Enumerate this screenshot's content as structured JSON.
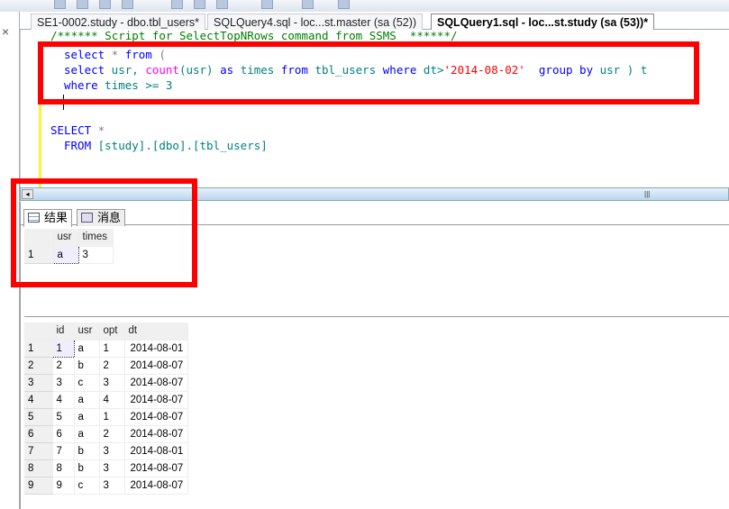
{
  "editor_tabs": [
    {
      "label": "SE1-0002.study - dbo.tbl_users*",
      "active": false
    },
    {
      "label": "SQLQuery4.sql - loc...st.master (sa (52))",
      "active": false
    },
    {
      "label": "SQLQuery1.sql - loc...st.study (sa (53))*",
      "active": true
    }
  ],
  "close_label": "×",
  "code": {
    "comment": "/****** Script for SelectTopNRows command from SSMS  ******/",
    "line1": {
      "a": "select",
      "b": " * ",
      "c": "from",
      "d": " ("
    },
    "line2": {
      "a": "select",
      "b": " usr, ",
      "c": "count",
      "d": "(usr) ",
      "e": "as",
      "f": " times ",
      "g": "from",
      "h": " tbl_users ",
      "i": "where",
      "j": " dt>",
      "k": "'2014-08-02'",
      "l": "  ",
      "m": "group by",
      "n": " usr ) t"
    },
    "line3": {
      "a": "where",
      "b": " times >= 3"
    },
    "line4": {
      "a": "SELECT",
      "b": " *"
    },
    "line5": {
      "a": "FROM",
      "b": " [study].[dbo].[tbl_users]"
    }
  },
  "results_tabs": [
    {
      "label": "结果",
      "icon": "grid-icon"
    },
    {
      "label": "消息",
      "icon": "messages-icon"
    }
  ],
  "grid1": {
    "columns": [
      "usr",
      "times"
    ],
    "rows": [
      [
        "1",
        "a",
        "3"
      ]
    ]
  },
  "grid2": {
    "columns": [
      "id",
      "usr",
      "opt",
      "dt"
    ],
    "rows": [
      [
        "1",
        "1",
        "a",
        "1",
        "2014-08-01"
      ],
      [
        "2",
        "2",
        "b",
        "2",
        "2014-08-07"
      ],
      [
        "3",
        "3",
        "c",
        "3",
        "2014-08-07"
      ],
      [
        "4",
        "4",
        "a",
        "4",
        "2014-08-07"
      ],
      [
        "5",
        "5",
        "a",
        "1",
        "2014-08-07"
      ],
      [
        "6",
        "6",
        "a",
        "2",
        "2014-08-07"
      ],
      [
        "7",
        "7",
        "b",
        "3",
        "2014-08-01"
      ],
      [
        "8",
        "8",
        "b",
        "3",
        "2014-08-07"
      ],
      [
        "9",
        "9",
        "c",
        "3",
        "2014-08-07"
      ]
    ]
  },
  "colors": {
    "highlight": "#ff0000",
    "keyword": "#0000ff",
    "function": "#ff00ff",
    "string": "#ff0000",
    "identifier": "#008080"
  }
}
